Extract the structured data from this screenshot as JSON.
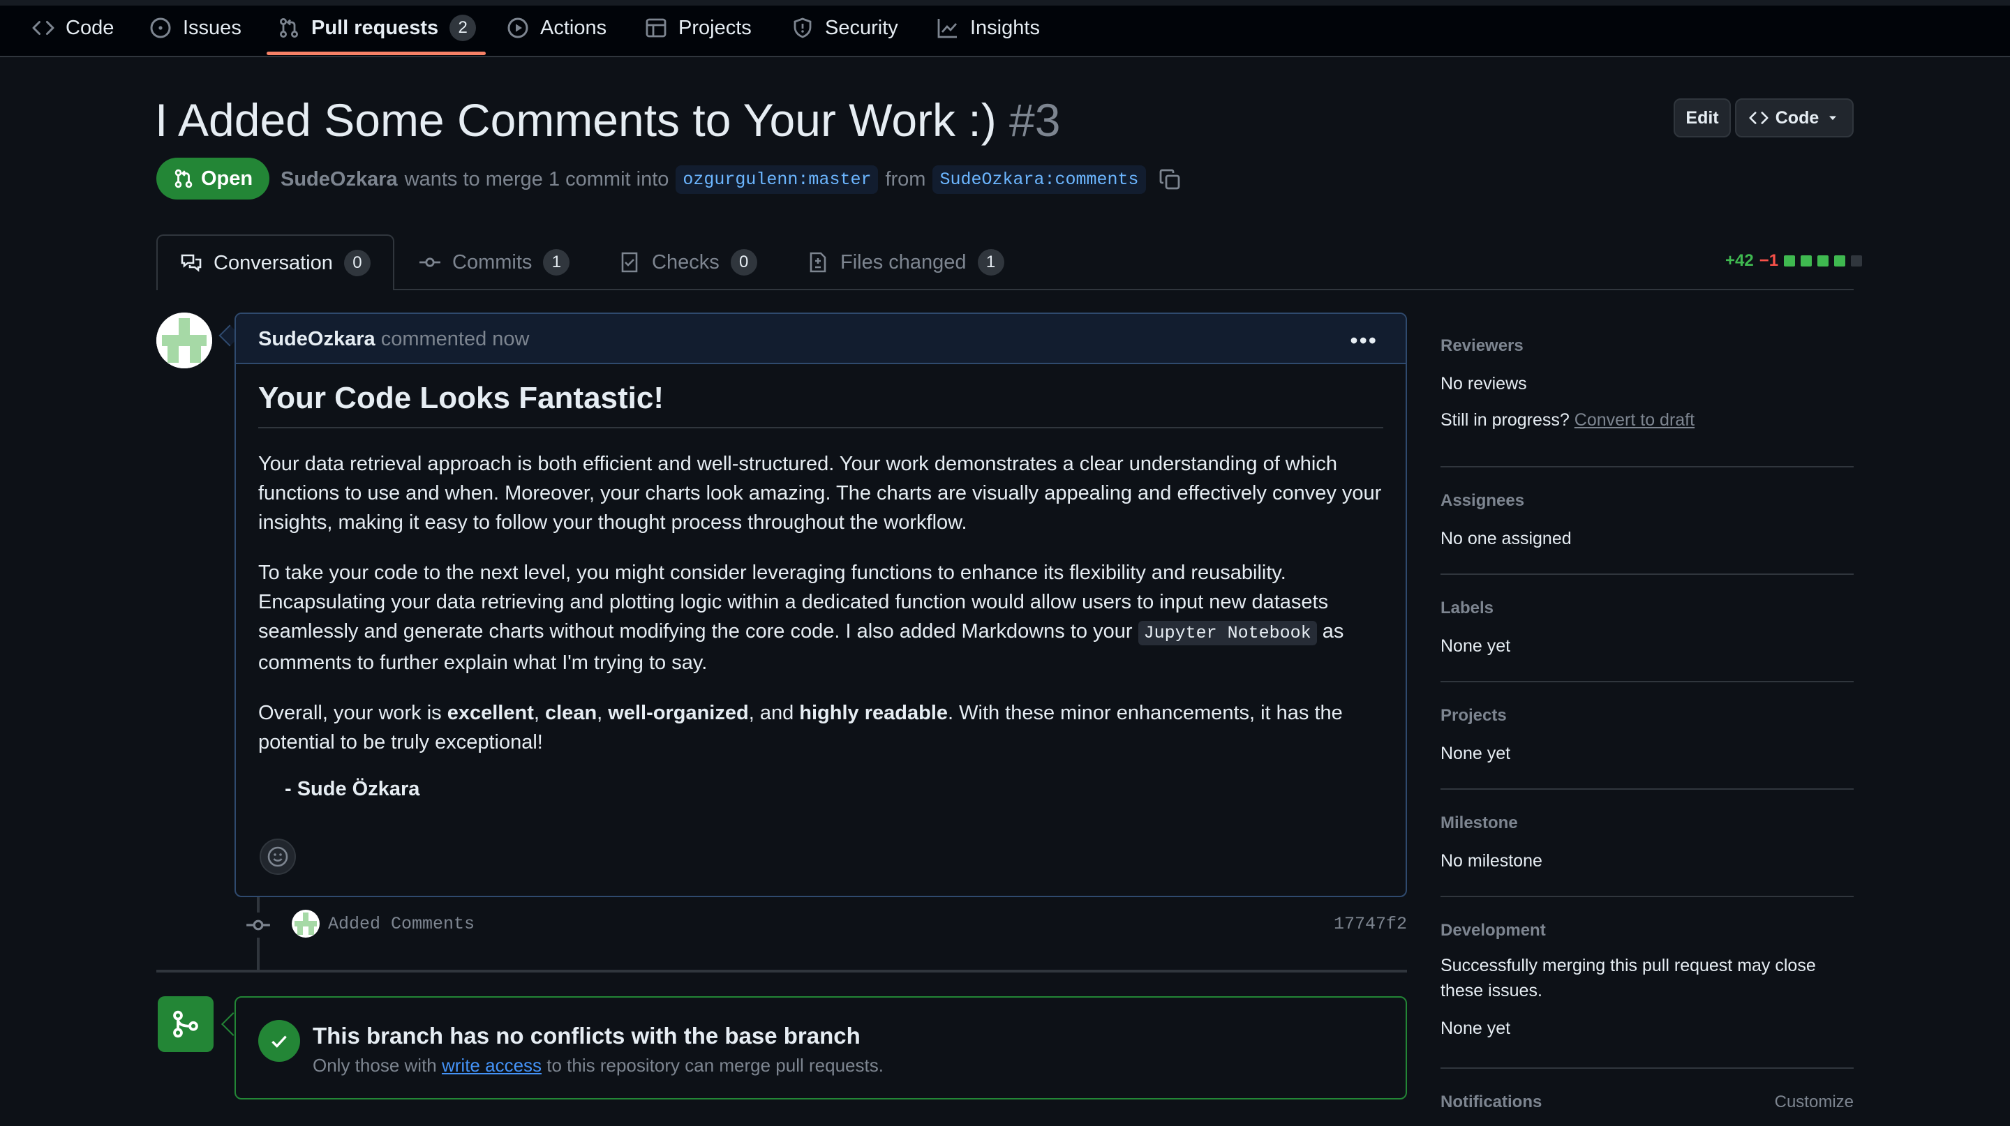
{
  "repo_nav": {
    "items": [
      {
        "label": "Code",
        "icon": "code-icon"
      },
      {
        "label": "Issues",
        "icon": "issue-opened-icon"
      },
      {
        "label": "Pull requests",
        "icon": "git-pull-request-icon",
        "count": "2",
        "active": true
      },
      {
        "label": "Actions",
        "icon": "play-icon"
      },
      {
        "label": "Projects",
        "icon": "table-icon"
      },
      {
        "label": "Security",
        "icon": "shield-icon"
      },
      {
        "label": "Insights",
        "icon": "graph-icon"
      }
    ]
  },
  "pr": {
    "title": "I Added Some Comments to Your Work :)",
    "number": "#3",
    "state": "Open",
    "author": "SudeOzkara",
    "merge_text": "wants to merge 1 commit into",
    "base_branch": "ozgurgulenn:master",
    "from_text": "from",
    "head_branch": "SudeOzkara:comments",
    "edit_label": "Edit",
    "code_label": "Code"
  },
  "tabs": [
    {
      "label": "Conversation",
      "count": "0",
      "icon": "comment-discussion-icon"
    },
    {
      "label": "Commits",
      "count": "1",
      "icon": "git-commit-icon"
    },
    {
      "label": "Checks",
      "count": "0",
      "icon": "checklist-icon"
    },
    {
      "label": "Files changed",
      "count": "1",
      "icon": "file-diff-icon"
    }
  ],
  "diffstat": {
    "additions": "+42",
    "deletions": "−1"
  },
  "comment": {
    "author": "SudeOzkara",
    "action": "commented now",
    "heading": "Your Code Looks Fantastic!",
    "p1": "Your data retrieval approach is both efficient and well-structured. Your work demonstrates a clear understanding of which functions to use and when. Moreover, your charts look amazing. The charts are visually appealing and effectively convey your insights, making it easy to follow your thought process throughout the workflow.",
    "p2_a": "To take your code to the next level, you might consider leveraging functions to enhance its flexibility and reusability. Encapsulating your data retrieving and plotting logic within a dedicated function would allow users to input new datasets seamlessly and generate charts without modifying the core code. I also added Markdowns to your",
    "p2_code": "Jupyter Notebook",
    "p2_b": "as comments to further explain what I'm trying to say.",
    "p3_a": "Overall, your work is",
    "p3_b1": "excellent",
    "p3_c1": ",",
    "p3_b2": "clean",
    "p3_c2": ",",
    "p3_b3": "well-organized",
    "p3_c3": ", and",
    "p3_b4": "highly readable",
    "p3_d": ". With these minor enhancements, it has the potential to be truly exceptional!",
    "signature": "- Sude Özkara"
  },
  "commit": {
    "message": "Added Comments",
    "sha": "17747f2"
  },
  "merge": {
    "title": "This branch has no conflicts with the base branch",
    "sub_a": "Only those with",
    "sub_link": "write access",
    "sub_b": "to this repository can merge pull requests."
  },
  "sidebar": {
    "reviewers": {
      "heading": "Reviewers",
      "value": "No reviews",
      "progress_text": "Still in progress?",
      "draft_link": "Convert to draft"
    },
    "assignees": {
      "heading": "Assignees",
      "value": "No one assigned"
    },
    "labels": {
      "heading": "Labels",
      "value": "None yet"
    },
    "projects": {
      "heading": "Projects",
      "value": "None yet"
    },
    "milestone": {
      "heading": "Milestone",
      "value": "No milestone"
    },
    "development": {
      "heading": "Development",
      "text": "Successfully merging this pull request may close these issues.",
      "value": "None yet"
    },
    "notifications": {
      "heading": "Notifications",
      "action": "Customize"
    }
  },
  "colors": {
    "accent_open": "#238636",
    "link": "#4493f8",
    "tab_underline": "#f78166"
  }
}
